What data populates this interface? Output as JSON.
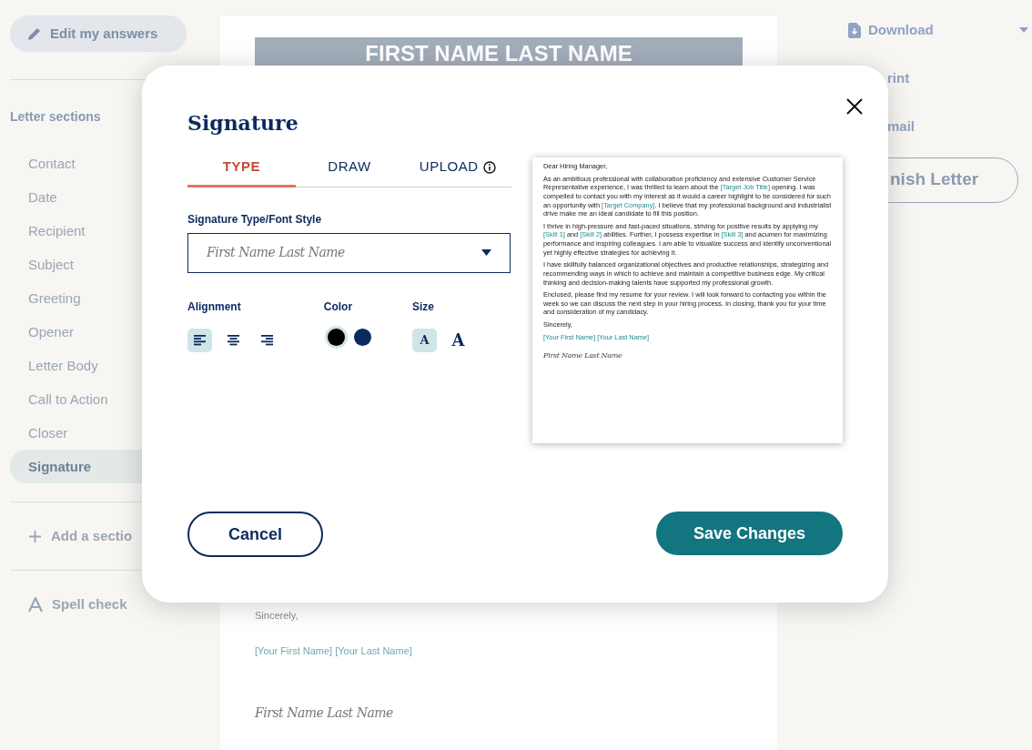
{
  "sidebar": {
    "edit_button": "Edit my answers",
    "section_heading": "Letter sections",
    "items": [
      {
        "label": "Contact",
        "selected": false
      },
      {
        "label": "Date",
        "selected": false
      },
      {
        "label": "Recipient",
        "selected": false
      },
      {
        "label": "Subject",
        "selected": false
      },
      {
        "label": "Greeting",
        "selected": false
      },
      {
        "label": "Opener",
        "selected": false
      },
      {
        "label": "Letter Body",
        "selected": false
      },
      {
        "label": "Call to Action",
        "selected": false
      },
      {
        "label": "Closer",
        "selected": false
      },
      {
        "label": "Signature",
        "selected": true
      }
    ],
    "add_section": "Add a sectio",
    "spell_check": "Spell check"
  },
  "document": {
    "name_banner": "FIRST NAME LAST NAME",
    "closing": "Sincerely,",
    "name_placeholder": "[Your First Name] [Your Last Name]",
    "signature": "First Name Last Name"
  },
  "actions": {
    "download": "Download",
    "print": "rint",
    "email": "mail",
    "finish": "nish Letter"
  },
  "modal": {
    "title": "Signature",
    "tabs": [
      {
        "label": "TYPE",
        "selected": true,
        "info": false
      },
      {
        "label": "DRAW",
        "selected": false,
        "info": false
      },
      {
        "label": "UPLOAD",
        "selected": false,
        "info": true
      }
    ],
    "font_field": {
      "label": "Signature Type/Font Style",
      "value": "First Name Last Name"
    },
    "alignment": {
      "label": "Alignment",
      "options": [
        {
          "kind": "left",
          "selected": true
        },
        {
          "kind": "center",
          "selected": false
        },
        {
          "kind": "right",
          "selected": false
        }
      ]
    },
    "color": {
      "label": "Color",
      "options": [
        {
          "color": "#000000",
          "selected": true
        },
        {
          "color": "#0b2a5e",
          "selected": false
        }
      ]
    },
    "size": {
      "label": "Size",
      "options": [
        {
          "glyph": "A",
          "kind": "small",
          "selected": true
        },
        {
          "glyph": "A",
          "kind": "large",
          "selected": false
        }
      ]
    },
    "preview": {
      "paragraphs": [
        [
          {
            "text": "Dear Hiring Manager,",
            "kind": "plain"
          }
        ],
        [
          {
            "text": "As an ambitious professional with collaboration proficiency and extensive Customer Service Representative experience, I was thrilled to learn about the ",
            "kind": "plain"
          },
          {
            "text": "[Target Job Title]",
            "kind": "placeholder"
          },
          {
            "text": " opening. I was compelled to contact you with my interest as it would a career highlight to be considered for such an opportunity with ",
            "kind": "plain"
          },
          {
            "text": "[Target Company]",
            "kind": "placeholder"
          },
          {
            "text": ". I believe that my professional background and industrialist drive make me an ideal candidate to fill this position.",
            "kind": "plain"
          }
        ],
        [
          {
            "text": "I thrive in high-pressure and fast-paced situations, striving for positive results by applying my ",
            "kind": "plain"
          },
          {
            "text": "[Skill 1]",
            "kind": "placeholder"
          },
          {
            "text": " and ",
            "kind": "plain"
          },
          {
            "text": "[Skill 2]",
            "kind": "placeholder"
          },
          {
            "text": " abilities. Further, I possess expertise in ",
            "kind": "plain"
          },
          {
            "text": "[Skill 3]",
            "kind": "placeholder"
          },
          {
            "text": " and acumen for maximizing performance and inspiring colleagues. I am able to visualize success and identify unconventional yet highly effective strategies for achieving it.",
            "kind": "plain"
          }
        ],
        [
          {
            "text": "I have skillfully balanced organizational objectives and productive relationships, strategizing and recommending ways in which to achieve and maintain a competitive business edge. My critical thinking and decision-making talents have supported my professional growth.",
            "kind": "plain"
          }
        ],
        [
          {
            "text": "Enclosed, please find my resume for your review. I will look forward to contacting you within the week so we can discuss the next step in your hiring process. In closing, thank you for your time and consideration of my candidacy.",
            "kind": "plain"
          }
        ],
        [
          {
            "text": "Sincerely,",
            "kind": "plain"
          }
        ],
        [
          {
            "text": "[Your First Name] [Your Last Name]",
            "kind": "placeholder"
          }
        ]
      ],
      "signature": "First Name Last Name"
    },
    "buttons": {
      "cancel": "Cancel",
      "save": "Save Changes"
    }
  }
}
